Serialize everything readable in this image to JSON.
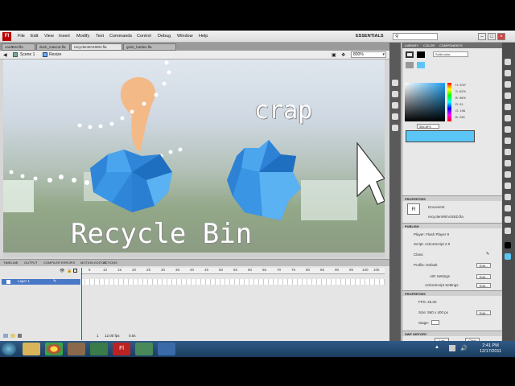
{
  "menubar": {
    "logo": "Fl",
    "items": [
      "File",
      "Edit",
      "View",
      "Insert",
      "Modify",
      "Text",
      "Commands",
      "Control",
      "Debug",
      "Window",
      "Help"
    ],
    "workspace": "ESSENTIALS"
  },
  "doc_tabs": [
    "cardBird.fla",
    "duck_mascot.fla",
    "recyclemEVISED.fla",
    "gridz_bottles.fla"
  ],
  "edit_bar": {
    "scene": "Scene 1",
    "symbol": "Resize",
    "zoom": "800%"
  },
  "stage": {
    "crap_label": "crap",
    "recycle_label": "Recycle Bin"
  },
  "timeline": {
    "tabs": [
      "TIMELINE",
      "OUTPUT",
      "COMPILER ERRORS",
      "MOTION EDITOR",
      "ACTIONS"
    ],
    "frame_numbers": [
      "5",
      "10",
      "15",
      "20",
      "25",
      "30",
      "35",
      "40",
      "45",
      "50",
      "55",
      "60",
      "65",
      "70",
      "75",
      "80",
      "85",
      "90",
      "95",
      "100",
      "105"
    ],
    "layer_name": "Layer 1",
    "status": [
      "1",
      "12.00 fps",
      "0.0s"
    ]
  },
  "color_panel": {
    "tabs": [
      "LIBRARY",
      "COLOR",
      "COMPONENTS"
    ],
    "type": "Solid color",
    "hex": "5BC6F5",
    "fields": [
      {
        "label": "H:",
        "value": "200°"
      },
      {
        "label": "S:",
        "value": "62%"
      },
      {
        "label": "B:",
        "value": "96%"
      },
      {
        "label": "R:",
        "value": "91"
      },
      {
        "label": "G:",
        "value": "198"
      },
      {
        "label": "B:",
        "value": "245"
      }
    ],
    "accent": "#5bc6f5"
  },
  "properties": {
    "header": "PROPERTIES",
    "doc_type": "Document",
    "doc_name": "recyclemREVISED.fla",
    "publish_header": "PUBLISH",
    "player": "Player: Flash Player 9",
    "script": "Script: ActionScript 2.0",
    "class_label": "Class:",
    "profile": "Profile: Default",
    "air_settings": "AIR Settings",
    "as_settings": "ActionScript Settings",
    "edit_button": "Edit...",
    "props_header": "PROPERTIES",
    "fps": "FPS: 25.00",
    "size": "Size: 550 x 400 px",
    "stage": "Stage:",
    "swf_header": "SWF HISTORY",
    "log_button": "Log",
    "clear_button": "Clear",
    "history": [
      {
        "size": "4.8 MB",
        "date": "10/31/2011",
        "time": "6:15 PM"
      },
      {
        "size": "4.8 MB",
        "date": "10/31/2011",
        "time": "5:46 PM"
      },
      {
        "size": "4.8 MB",
        "date": "10/31/2011",
        "time": "5:22 PM"
      }
    ]
  },
  "taskbar": {
    "time": "2:41 PM",
    "date": "12/17/2011"
  }
}
